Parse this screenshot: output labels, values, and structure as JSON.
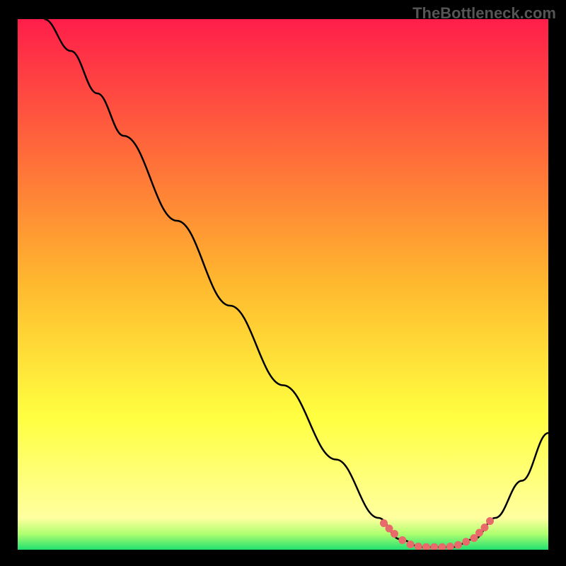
{
  "watermark": "TheBottleneck.com",
  "chart_data": {
    "type": "line",
    "title": "",
    "xlabel": "",
    "ylabel": "",
    "xlim": [
      0,
      100
    ],
    "ylim": [
      0,
      100
    ],
    "background_gradient": {
      "stops": [
        {
          "offset": 0,
          "color": "#ff1e4a"
        },
        {
          "offset": 25,
          "color": "#ff6a3a"
        },
        {
          "offset": 50,
          "color": "#ffb92e"
        },
        {
          "offset": 75,
          "color": "#ffff40"
        },
        {
          "offset": 94,
          "color": "#ffffa0"
        },
        {
          "offset": 97,
          "color": "#b0ff70"
        },
        {
          "offset": 100,
          "color": "#20e070"
        }
      ]
    },
    "series": [
      {
        "name": "curve",
        "color": "#000000",
        "points": [
          {
            "x": 5,
            "y": 100
          },
          {
            "x": 10,
            "y": 94
          },
          {
            "x": 15,
            "y": 86
          },
          {
            "x": 20,
            "y": 78
          },
          {
            "x": 30,
            "y": 62
          },
          {
            "x": 40,
            "y": 46
          },
          {
            "x": 50,
            "y": 31
          },
          {
            "x": 60,
            "y": 17
          },
          {
            "x": 68,
            "y": 6
          },
          {
            "x": 72,
            "y": 2
          },
          {
            "x": 76,
            "y": 0.5
          },
          {
            "x": 82,
            "y": 0.5
          },
          {
            "x": 86,
            "y": 2
          },
          {
            "x": 90,
            "y": 6
          },
          {
            "x": 95,
            "y": 13
          },
          {
            "x": 100,
            "y": 22
          }
        ]
      },
      {
        "name": "highlight-dots",
        "color": "#e86a6a",
        "points": [
          {
            "x": 69,
            "y": 5.0
          },
          {
            "x": 70,
            "y": 4.0
          },
          {
            "x": 71,
            "y": 3.0
          },
          {
            "x": 72.5,
            "y": 1.8
          },
          {
            "x": 74,
            "y": 1.0
          },
          {
            "x": 75.5,
            "y": 0.6
          },
          {
            "x": 77,
            "y": 0.5
          },
          {
            "x": 78.5,
            "y": 0.5
          },
          {
            "x": 80,
            "y": 0.5
          },
          {
            "x": 81.5,
            "y": 0.6
          },
          {
            "x": 83,
            "y": 0.9
          },
          {
            "x": 84.5,
            "y": 1.5
          },
          {
            "x": 86,
            "y": 2.2
          },
          {
            "x": 87,
            "y": 3.2
          },
          {
            "x": 88,
            "y": 4.2
          },
          {
            "x": 89,
            "y": 5.4
          }
        ]
      }
    ]
  }
}
